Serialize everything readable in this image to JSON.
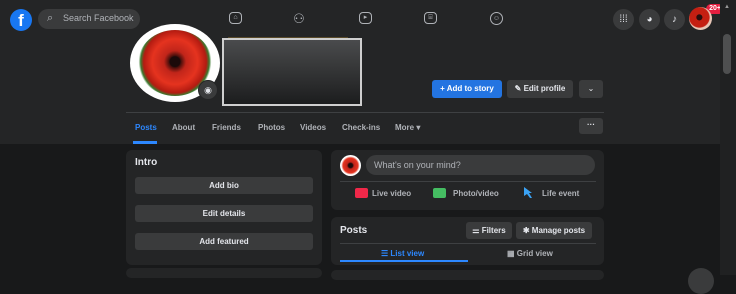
{
  "topbar": {
    "logo_letter": "f",
    "search_icon": "search-icon",
    "search_placeholder": "Search Facebook",
    "nav_icons": [
      "home-icon",
      "friends-icon",
      "watch-icon",
      "marketplace-icon",
      "groups-icon"
    ],
    "right_icons": [
      "menu-grid-icon",
      "messenger-icon",
      "notifications-icon"
    ],
    "notification_badge": "20+"
  },
  "profile": {
    "camera_icon": "camera-icon",
    "buttons": {
      "add_to_story": "+ Add to story",
      "edit_profile": "✎ Edit profile",
      "more": "⌄"
    },
    "tabs": [
      "Posts",
      "About",
      "Friends",
      "Photos",
      "Videos",
      "Check-ins",
      "More ▾"
    ],
    "active_tab": "Posts",
    "dots_button": "···"
  },
  "intro": {
    "title": "Intro",
    "buttons": [
      "Add bio",
      "Edit details",
      "Add featured"
    ]
  },
  "composer": {
    "placeholder": "What's on your mind?",
    "actions": [
      "Live video",
      "Photo/video",
      "Life event"
    ]
  },
  "posts": {
    "title": "Posts",
    "filters": "⚌ Filters",
    "manage": "✱ Manage posts",
    "views": [
      "☰ List view",
      "▦ Grid view"
    ],
    "active_view": "List view"
  },
  "colors": {
    "background": "#18191a",
    "card": "#242526",
    "button": "#3a3b3c",
    "accent": "#2374e1",
    "link": "#2d88ff",
    "live": "#f02849",
    "photo": "#45bd62",
    "badge": "#e41e3f"
  }
}
